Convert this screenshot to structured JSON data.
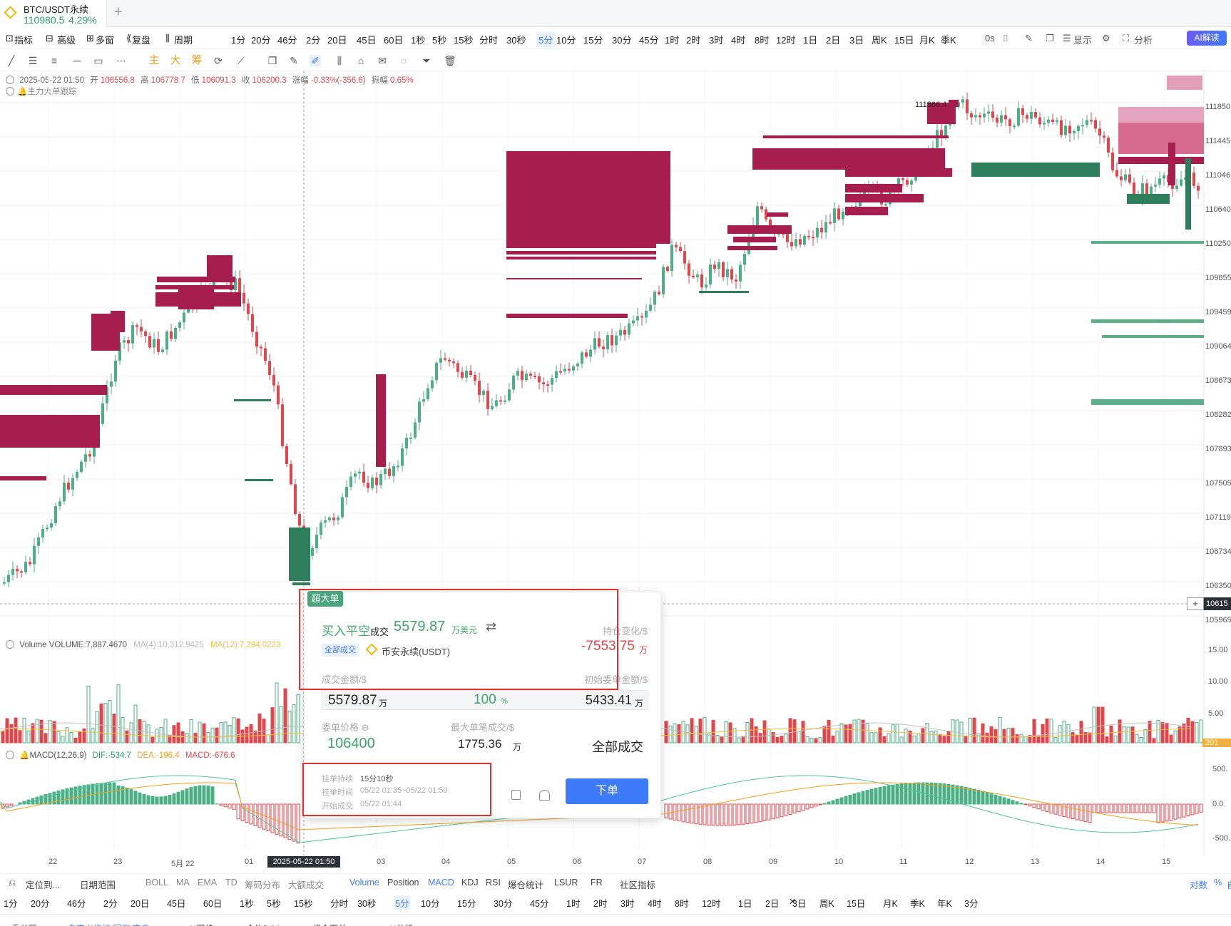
{
  "tab": {
    "symbol": "BTC/USDT永续",
    "price": "110980.5",
    "change": "4.29%"
  },
  "toolbar": {
    "items": [
      "指标",
      "高级",
      "多窗",
      "复盘",
      "周期",
      "1分",
      "20分",
      "46分",
      "2分",
      "20日",
      "45日",
      "60日",
      "1秒",
      "5秒",
      "15秒",
      "分时",
      "30秒",
      "5分",
      "10分",
      "15分",
      "30分",
      "45分",
      "1时",
      "2时",
      "3时",
      "4时",
      "8时",
      "12时",
      "1日",
      "2日",
      "3日",
      "周K",
      "15日",
      "月K",
      "季K"
    ],
    "active": "5分",
    "right_items": [
      "0s",
      "显示",
      "分析"
    ],
    "ai_label": "AI解读"
  },
  "drawtools": {
    "orange": [
      "主",
      "大",
      "筹"
    ]
  },
  "info": {
    "datetime": "2025-05-22 01:50",
    "open_label": "开",
    "open": "106556.8",
    "high_label": "高",
    "high": "106778.7",
    "low_label": "低",
    "low": "106091.3",
    "close_label": "收",
    "close": "106200.3",
    "chg_label": "涨幅",
    "chg": "-0.33%(-356.6)",
    "amp_label": "振幅",
    "amp": "0.65%",
    "tracker": "主力大单跟踪"
  },
  "price_axis": [
    "111850",
    "111445",
    "111046",
    "110640",
    "110250",
    "109855",
    "109459",
    "109064",
    "108673",
    "108282",
    "107893",
    "107505",
    "107119",
    "106734",
    "106350",
    "105965"
  ],
  "current_price_label": "10615",
  "max_price_label": "111866.4",
  "volume_header": {
    "label": "Volume",
    "value": "VOLUME:7,887.4670",
    "ma4": "MA(4):10,312.9425",
    "ma12": "MA(12):7,294.0223",
    "axis": [
      "15.00",
      "10.00",
      "5.00"
    ],
    "current": "201"
  },
  "macd_header": {
    "label": "MACD(12,26,9)",
    "dif": "DIF:-534.7",
    "dea": "DEA:-196.4",
    "macd": "MACD:-676.6",
    "axis": [
      "500.",
      "0.0",
      "-500."
    ]
  },
  "time_axis": [
    "22",
    "23",
    "5月 22",
    "01",
    "03",
    "04",
    "05",
    "06",
    "07",
    "08",
    "09",
    "10",
    "11",
    "12",
    "13",
    "14",
    "15"
  ],
  "cursor_time": "2025-05-22 01:50",
  "indicator_bar": {
    "items": [
      "定位到...",
      "日期范围",
      "BOLL",
      "MA",
      "EMA",
      "TD",
      "筹码分布",
      "大额成交",
      "Volume",
      "Position",
      "MACD",
      "KDJ",
      "RSI",
      "爆仓统计",
      "LSUR",
      "FR",
      "社区指标"
    ],
    "active": [
      "Volume",
      "MACD"
    ],
    "right": [
      "对数",
      "%",
      "自"
    ]
  },
  "period_bar": {
    "items": [
      "1分",
      "20分",
      "46分",
      "2分",
      "20日",
      "45日",
      "60日",
      "1秒",
      "5秒",
      "15秒",
      "分时",
      "30秒",
      "5分",
      "10分",
      "15分",
      "30分",
      "45分",
      "1时",
      "2时",
      "3时",
      "4时",
      "8时",
      "12时",
      "1日",
      "2日",
      "3日",
      "周K",
      "15日",
      "月K",
      "季K",
      "年K",
      "3分"
    ],
    "active": "5分"
  },
  "bottom_tabs": {
    "items": [
      "委单区",
      "自定义指标/回测/实盘",
      "AI网格",
      "合约DCA",
      "组合下单",
      "AI分析"
    ],
    "active": "自定义指标/回测/实盘"
  },
  "popup": {
    "badge": "超大单",
    "title": "买入平空",
    "title_suffix": "成交",
    "amount": "5579.87",
    "amount_unit": "万美元",
    "position_change_label": "持仓变化/$",
    "tag": "全部成交",
    "exchange": "币安永续(USDT)",
    "position_change": "-7553.75",
    "position_change_unit": "万",
    "deal_label": "成交金额/$",
    "init_label": "初始委单金额/$",
    "deal_amount": "5579.87",
    "deal_unit": "万",
    "fill_pct": "100",
    "fill_pct_unit": "%",
    "init_amount": "5433.41",
    "init_unit": "万",
    "price_label": "委单价格",
    "max_label": "最大单笔成交/$",
    "price": "106400",
    "max_amount": "1775.36",
    "max_unit": "万",
    "status": "全部成交",
    "duration_label": "挂单持续",
    "duration": "15分10秒",
    "time_label": "挂单时间",
    "time": "05/22 01:35~05/22 01:50",
    "start_label": "开始成交",
    "start": "05/22 01:44",
    "order_button": "下单"
  },
  "colors": {
    "up": "#4caf86",
    "down": "#e0474c",
    "wall_red": "#a61e4d",
    "wall_green": "#2e7d5b",
    "accent": "#3e7bfa"
  }
}
